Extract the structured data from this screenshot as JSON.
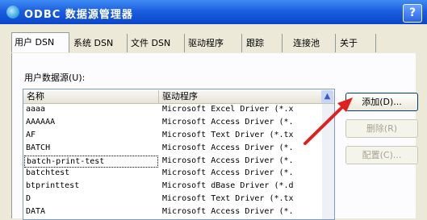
{
  "window": {
    "title": "ODBC 数据源管理器",
    "help_label": "?"
  },
  "tabs": [
    "用户 DSN",
    "系统 DSN",
    "文件 DSN",
    "驱动程序",
    "跟踪",
    "连接池",
    "关于"
  ],
  "section_label": "用户数据源(U):",
  "columns": {
    "name": "名称",
    "driver": "驱动程序"
  },
  "rows": [
    {
      "name": "aaaa",
      "driver": "Microsoft Excel Driver (*.x"
    },
    {
      "name": "AAAAAA",
      "driver": "Microsoft Access Driver (*."
    },
    {
      "name": "AF",
      "driver": "Microsoft Text Driver (*.tx"
    },
    {
      "name": "BATCH",
      "driver": "Microsoft Access Driver (*."
    },
    {
      "name": "batch-print-test",
      "driver": "Microsoft Access Driver (*."
    },
    {
      "name": "batchtest",
      "driver": "Microsoft Access Driver (*."
    },
    {
      "name": "btprinttest",
      "driver": "Microsoft dBase Driver (*.d"
    },
    {
      "name": "D",
      "driver": "Microsoft Text Driver (*.tx"
    },
    {
      "name": "DATA",
      "driver": "Microsoft Access Driver (*."
    }
  ],
  "buttons": {
    "add": "添加(D)...",
    "remove": "删除(R)",
    "configure": "配置(C)..."
  },
  "colors": {
    "title_bar": "#0a46c9",
    "arrow": "#e02020",
    "dialog_bg": "#ece9d8"
  },
  "icons": {
    "title": "odbc-globe-icon",
    "scroll_up": "up-arrow-icon",
    "pointer": "red-arrow-icon"
  }
}
